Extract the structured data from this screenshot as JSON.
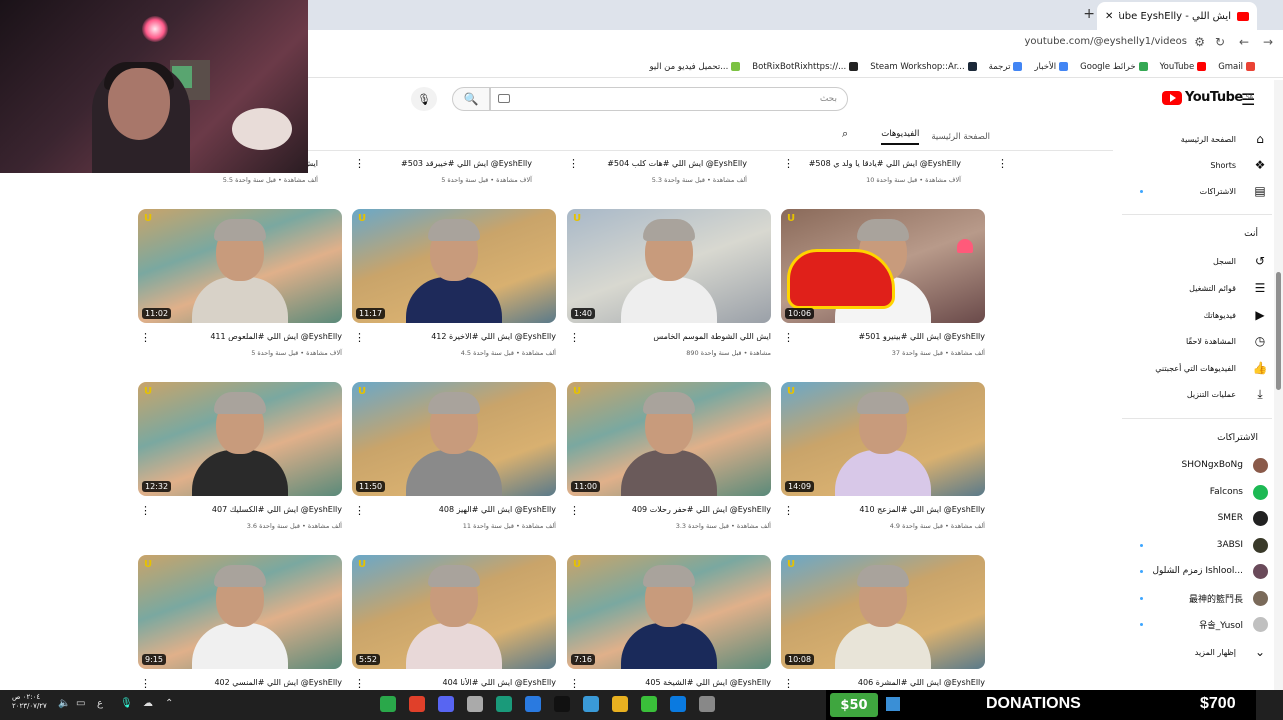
{
  "browser": {
    "tab_title": "ايش اللي - YouTube EyshElly",
    "url": "youtube.com/@eyshelly1/videos",
    "bookmarks": [
      {
        "label": "Gmail",
        "color": "#ea4335"
      },
      {
        "label": "YouTube",
        "color": "#ff0000"
      },
      {
        "label": "Google خرائط",
        "color": "#34a853"
      },
      {
        "label": "الأخبار",
        "color": "#4285f4"
      },
      {
        "label": "ترجمة",
        "color": "#4285f4"
      },
      {
        "label": "Steam Workshop::Ar...",
        "color": "#1b2838"
      },
      {
        "label": "BotRixBotRixhttps://...",
        "color": "#222222"
      },
      {
        "label": "تحميل فيديو من اليو...",
        "color": "#7cc242"
      }
    ]
  },
  "header": {
    "logo_text": "YouTube",
    "logo_region": "SA",
    "search_placeholder": "بحث"
  },
  "channel_tabs": {
    "home": "الصفحة الرئيسية",
    "videos": "الفيديوهات"
  },
  "sidebar": {
    "main": [
      {
        "label": "الصفحة الرئيسية",
        "icon": "home-icon",
        "glyph": "⌂"
      },
      {
        "label": "Shorts",
        "icon": "shorts-icon",
        "glyph": "❖"
      },
      {
        "label": "الاشتراكات",
        "icon": "subscriptions-icon",
        "glyph": "▤"
      }
    ],
    "you_header": "أنت",
    "you": [
      {
        "label": "السجل",
        "icon": "history-icon",
        "glyph": "↺"
      },
      {
        "label": "قوائم التشغيل",
        "icon": "playlists-icon",
        "glyph": "☰"
      },
      {
        "label": "فيديوهاتك",
        "icon": "your-videos-icon",
        "glyph": "▶"
      },
      {
        "label": "المشاهدة لاحقًا",
        "icon": "watch-later-icon",
        "glyph": "◷"
      },
      {
        "label": "الفيديوهات التي أعجبتني",
        "icon": "liked-icon",
        "glyph": "👍"
      },
      {
        "label": "عمليات التنزيل",
        "icon": "downloads-icon",
        "glyph": "⤓"
      }
    ],
    "subs_header": "الاشتراكات",
    "subscriptions": [
      {
        "label": "SHONgxBoNg",
        "color": "#8a5a4a",
        "dot": false
      },
      {
        "label": "Falcons",
        "color": "#1db954",
        "dot": false
      },
      {
        "label": "SMER",
        "color": "#222222",
        "dot": false
      },
      {
        "label": "3ABSI",
        "color": "#3a3a2a",
        "dot": true
      },
      {
        "label": "زمزم الشلول Ishlool...",
        "color": "#6a4a5a",
        "dot": true
      },
      {
        "label": "最神的籃鬥長",
        "color": "#7a6a5a",
        "dot": true
      },
      {
        "label": "유솔_Yusol",
        "color": "#c0c0c0",
        "dot": true
      }
    ],
    "show_more": "إظهار المزيد"
  },
  "top_row": [
    {
      "title": "#ايش اللي",
      "meta": "5.5 ألف مشاهدة • قبل سنة واحدة"
    },
    {
      "title": "#ايش اللي #خيبرقد 503 @EyshElly",
      "meta": "5 آلاف مشاهدة • قبل سنة واحدة"
    },
    {
      "title": "#ايش اللي #هات كلب 504 @EyshElly",
      "meta": "5.3 ألف مشاهدة • قبل سنة واحدة"
    },
    {
      "title": "#ايش اللي #يادقا يا ولد ي 508 @EyshElly",
      "meta": "10 آلاف مشاهدة • قبل سنة واحدة"
    }
  ],
  "videos": [
    {
      "duration": "11:02",
      "title": "ايش اللي #الملعوص 411 @EyshElly",
      "meta": "5 آلاف مشاهدة • قبل سنة واحدة",
      "shirt": "#d8d2c8"
    },
    {
      "duration": "11:17",
      "title": "ايش اللي #الاخيرة 412 @EyshElly",
      "meta": "4.5 ألف مشاهدة • قبل سنة واحدة",
      "shirt": "#1e2a5a"
    },
    {
      "duration": "1:40",
      "title": "ايش اللي الشوطة الموسم الخامس",
      "meta": "890 مشاهدة • قبل سنة واحدة",
      "shirt": "#eeeeee"
    },
    {
      "duration": "10:06",
      "title": "#ايش اللي #بينيرو 501 @EyshElly",
      "meta": "37 ألف مشاهدة • قبل سنة واحدة",
      "shirt": "#f4f4f4"
    },
    {
      "duration": "12:32",
      "title": "ايش اللي #الكسليك 407 @EyshElly",
      "meta": "3.6 ألف مشاهدة • قبل سنة واحدة",
      "shirt": "#2a2a2a"
    },
    {
      "duration": "11:50",
      "title": "ايش اللي #الهيز 408 @EyshElly",
      "meta": "11 ألف مشاهدة • قبل سنة واحدة",
      "shirt": "#8a8a8a"
    },
    {
      "duration": "11:00",
      "title": "ايش اللي #حفر رحلات 409 @EyshElly",
      "meta": "3.3 ألف مشاهدة • قبل سنة واحدة",
      "shirt": "#6a5a5a"
    },
    {
      "duration": "14:09",
      "title": "ايش اللي #المزعج 410 @EyshElly",
      "meta": "4.9 ألف مشاهدة • قبل سنة واحدة",
      "shirt": "#d8c8e8"
    },
    {
      "duration": "9:15",
      "title": "ايش اللي #المنسي 402 @EyshElly",
      "meta": "",
      "shirt": "#f0f0f0"
    },
    {
      "duration": "5:52",
      "title": "ايش اللي #الأنا 404 @EyshElly",
      "meta": "",
      "shirt": "#e8d8d8"
    },
    {
      "duration": "7:16",
      "title": "ايش اللي #الشيخة 405 @EyshElly",
      "meta": "",
      "shirt": "#1a2a5a"
    },
    {
      "duration": "10:08",
      "title": "ايش اللي #المشرة 406 @EyshElly",
      "meta": "",
      "shirt": "#e8e4d8"
    }
  ],
  "taskbar": {
    "time": "٠٢:٠٤ ص",
    "date": "٢٠٢٣/٠٧/٢٧"
  },
  "overlay": {
    "left_amount": "$50",
    "label": "DONATIONS",
    "total": "$700"
  }
}
